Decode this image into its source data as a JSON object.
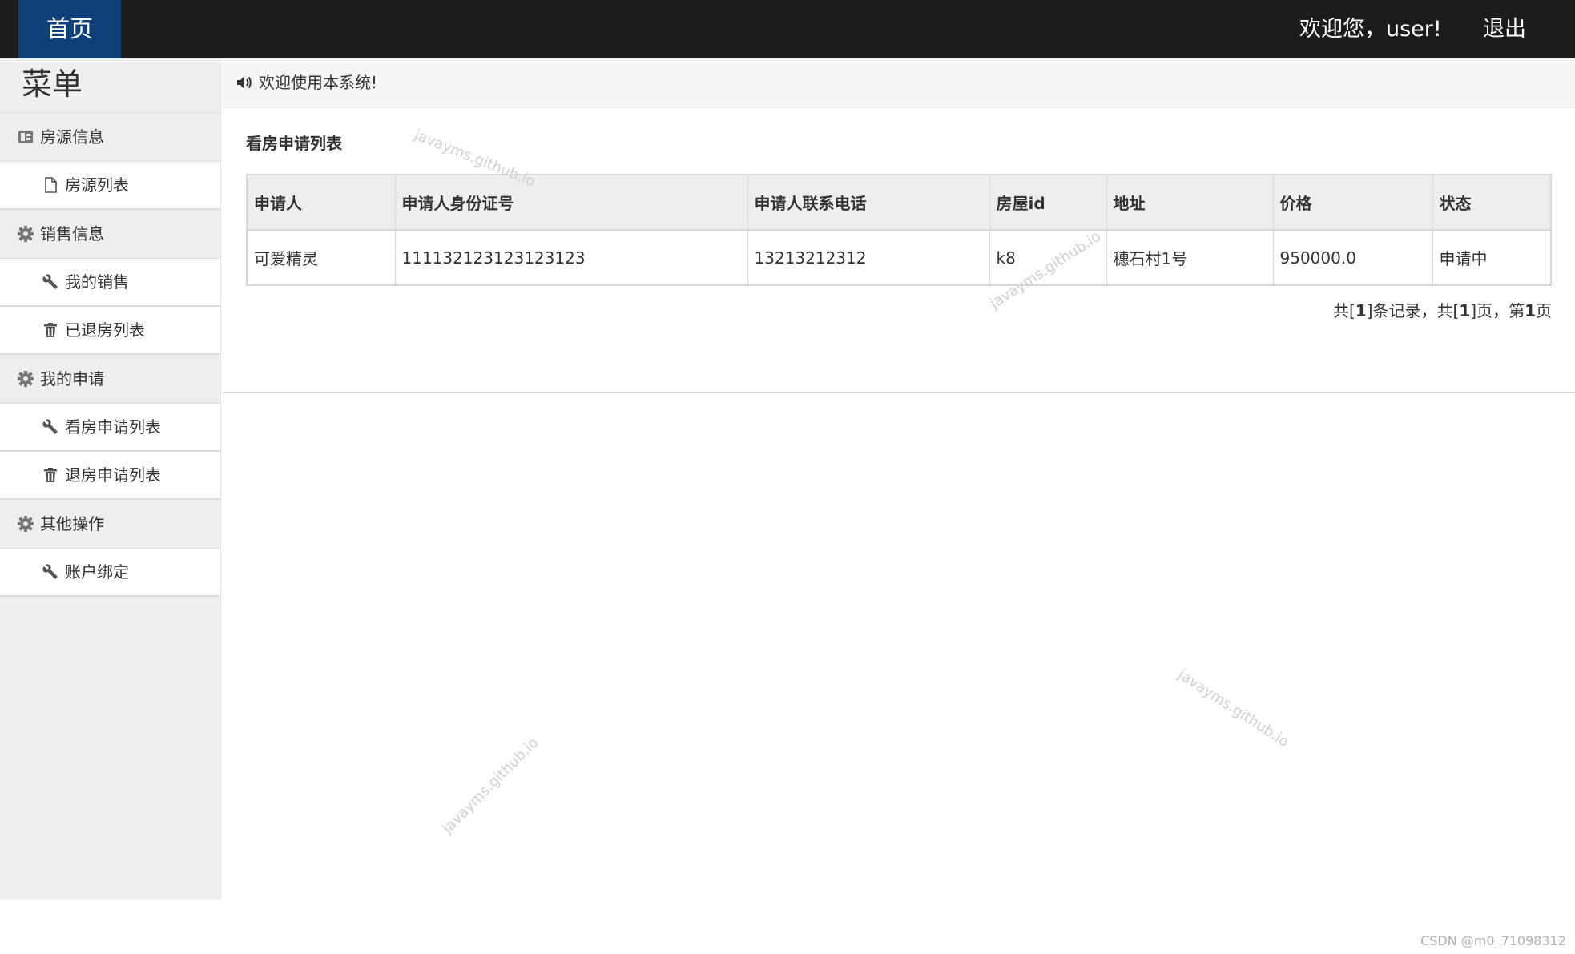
{
  "topbar": {
    "home": "首页",
    "welcome": "欢迎您，user!",
    "logout": "退出"
  },
  "sidebar": {
    "title": "菜单",
    "groups": [
      {
        "label": "房源信息",
        "icon": "card-icon",
        "items": [
          {
            "label": "房源列表",
            "icon": "file-icon"
          }
        ]
      },
      {
        "label": "销售信息",
        "icon": "gear-icon",
        "items": [
          {
            "label": "我的销售",
            "icon": "wrench-icon"
          },
          {
            "label": "已退房列表",
            "icon": "trash-icon"
          }
        ]
      },
      {
        "label": "我的申请",
        "icon": "gear-icon",
        "items": [
          {
            "label": "看房申请列表",
            "icon": "wrench-icon"
          },
          {
            "label": "退房申请列表",
            "icon": "trash-icon"
          }
        ]
      },
      {
        "label": "其他操作",
        "icon": "gear-icon",
        "items": [
          {
            "label": "账户绑定",
            "icon": "wrench-icon"
          }
        ]
      }
    ]
  },
  "notice": {
    "text": "欢迎使用本系统!",
    "icon": "speaker-icon"
  },
  "panel": {
    "title": "看房申请列表",
    "columns": [
      "申请人",
      "申请人身份证号",
      "申请人联系电话",
      "房屋id",
      "地址",
      "价格",
      "状态"
    ],
    "rows": [
      [
        "可爱精灵",
        "111132123123123123",
        "13213212312",
        "k8",
        "穗石村1号",
        "950000.0",
        "申请中"
      ]
    ],
    "pager": {
      "p1": "共[",
      "records": "1",
      "p2": "]条记录，共[",
      "pages": "1",
      "p3": "]页，第",
      "current": "1",
      "p4": "页"
    }
  },
  "watermark": "javayms.github.io",
  "credit": "CSDN @m0_71098312",
  "colors": {
    "topbar": "#1c1c1c",
    "home_tab": "#0f3f78",
    "sidebar": "#efefef"
  }
}
